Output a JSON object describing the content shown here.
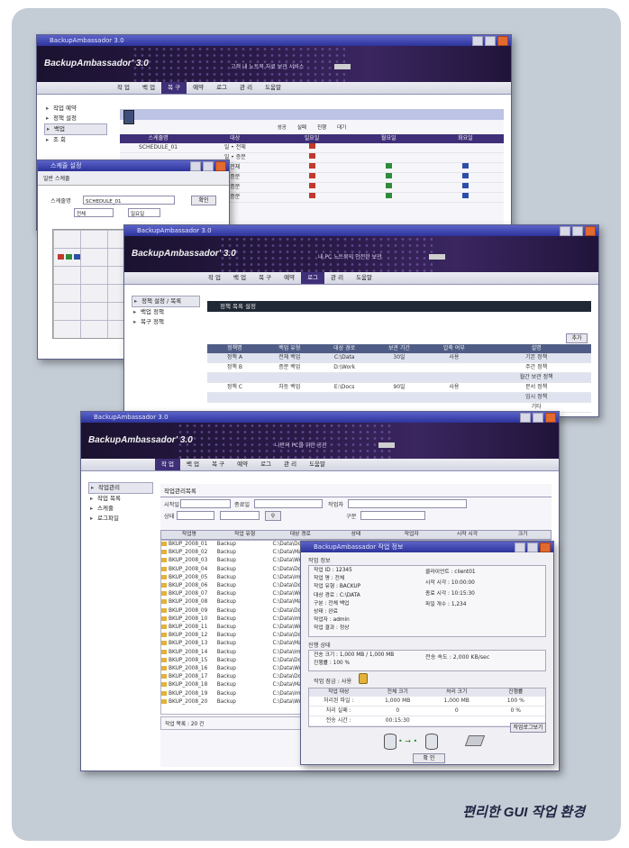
{
  "caption": "편리한 GUI 작업 환경",
  "app": {
    "logo": "BackupAmbassador' 3.0",
    "tagline1": "고객 내 노트북 자료 보관 서비스",
    "tagline2": "내 PC 노트북의 안전한 보관",
    "tagline3": "나만의 PC를 위한 공간",
    "menu": [
      "작 업",
      "백 업",
      "복 구",
      "예약",
      "로그",
      "관 리",
      "도움말"
    ]
  },
  "win1": {
    "title": "BackupAmbassador 3.0",
    "tree": [
      "작업 예약",
      "정책 설정",
      "백업",
      "조 회"
    ],
    "legend": [
      "성공",
      "실패",
      "진행",
      "대기"
    ],
    "columns": [
      "스케줄명",
      "대상",
      "일요일",
      "월요일",
      "화요일"
    ],
    "rows": [
      [
        "SCHEDULE_01",
        "일 • 전체",
        "r",
        "",
        ""
      ],
      [
        "",
        "일 • 증분",
        "r",
        "",
        ""
      ],
      [
        "",
        "전체",
        "r",
        "g",
        "b"
      ],
      [
        "",
        "증분",
        "r",
        "g",
        "b"
      ],
      [
        "",
        "증분",
        "r",
        "g",
        "b"
      ],
      [
        "",
        "증분",
        "r",
        "g",
        "b"
      ]
    ]
  },
  "win2": {
    "title": "스케줄 설정",
    "tab": "일반 스케줄",
    "field_label": "스케줄명",
    "field_value": "SCHEDULE_01",
    "select1": "전체",
    "select2": "일요일",
    "ok_label": "확인",
    "close_label": "닫기"
  },
  "win3": {
    "title": "BackupAmbassador 3.0",
    "tree": [
      "정책 설정 / 목록",
      "백업 정책",
      "복구 정책"
    ],
    "section": "정책 목록 설정",
    "add_label": "추가",
    "columns": [
      "정책명",
      "백업 유형",
      "대상 경로",
      "보관 기간",
      "압축 여부",
      "설명"
    ],
    "rows": [
      [
        "정책 A",
        "전체 백업",
        "C:\\Data",
        "30일",
        "사용",
        "기본 정책"
      ],
      [
        "정책 B",
        "증분 백업",
        "D:\\Work",
        "",
        "",
        "주간 정책"
      ],
      [
        "",
        "",
        "",
        "",
        "",
        "월간 보관 정책"
      ],
      [
        "정책 C",
        "차등 백업",
        "E:\\Docs",
        "90일",
        "사용",
        "문서 정책"
      ],
      [
        "",
        "",
        "",
        "",
        "",
        "임시 정책"
      ],
      [
        "",
        "",
        "",
        "",
        "",
        "기타"
      ]
    ]
  },
  "win4": {
    "title": "BackupAmbassador 3.0",
    "tree": [
      "작업관리",
      "작업 목록",
      "스케줄",
      "로그파일"
    ],
    "section": "작업관리목록",
    "filter_labels": [
      "시작일",
      "종료일",
      "작업자",
      "상태",
      "구분"
    ],
    "columns": [
      "작업명",
      "작업 유형",
      "대상 경로",
      "상태",
      "작업자",
      "시작 시각",
      "크기"
    ],
    "files": [
      [
        "BKUP_2008_01",
        "Backup",
        "C:\\Data\\Docs",
        "완료",
        "admin",
        "2008-11-21 10:00",
        "3.2MB"
      ],
      [
        "BKUP_2008_02",
        "Backup",
        "C:\\Data\\Mail",
        "완료",
        "admin",
        "2008-11-21 10:05",
        "1.1MB"
      ],
      [
        "BKUP_2008_03",
        "Backup",
        "C:\\Data\\Work",
        "완료",
        "admin",
        "2008-11-21 10:10",
        "4.7MB"
      ],
      [
        "BKUP_2008_04",
        "Backup",
        "C:\\Data\\Docs",
        "완료",
        "admin",
        "2008-11-21 10:15",
        "0.8MB"
      ],
      [
        "BKUP_2008_05",
        "Backup",
        "C:\\Data\\Img",
        "완료",
        "admin",
        "2008-11-21 10:20",
        "2.3MB"
      ],
      [
        "BKUP_2008_06",
        "Backup",
        "C:\\Data\\Docs",
        "완료",
        "admin",
        "2008-11-21 10:25",
        "1.9MB"
      ],
      [
        "BKUP_2008_07",
        "Backup",
        "C:\\Data\\Work",
        "완료",
        "admin",
        "2008-11-21 10:30",
        "5.0MB"
      ],
      [
        "BKUP_2008_08",
        "Backup",
        "C:\\Data\\Mail",
        "완료",
        "admin",
        "2008-11-21 10:35",
        "0.6MB"
      ],
      [
        "BKUP_2008_09",
        "Backup",
        "C:\\Data\\Docs",
        "완료",
        "admin",
        "2008-11-21 10:40",
        "2.8MB"
      ],
      [
        "BKUP_2008_10",
        "Backup",
        "C:\\Data\\Img",
        "완료",
        "admin",
        "2008-11-21 10:45",
        "3.6MB"
      ],
      [
        "BKUP_2008_11",
        "Backup",
        "C:\\Data\\Work",
        "완료",
        "admin",
        "2008-11-21 10:50",
        "1.4MB"
      ],
      [
        "BKUP_2008_12",
        "Backup",
        "C:\\Data\\Docs",
        "완료",
        "admin",
        "2008-11-21 10:55",
        "2.0MB"
      ],
      [
        "BKUP_2008_13",
        "Backup",
        "C:\\Data\\Mail",
        "완료",
        "admin",
        "2008-11-21 11:00",
        "0.9MB"
      ],
      [
        "BKUP_2008_14",
        "Backup",
        "C:\\Data\\Img",
        "완료",
        "admin",
        "2008-11-21 11:05",
        "4.1MB"
      ],
      [
        "BKUP_2008_15",
        "Backup",
        "C:\\Data\\Docs",
        "완료",
        "admin",
        "2008-11-21 11:10",
        "1.7MB"
      ],
      [
        "BKUP_2008_16",
        "Backup",
        "C:\\Data\\Work",
        "완료",
        "admin",
        "2008-11-21 11:15",
        "2.5MB"
      ],
      [
        "BKUP_2008_17",
        "Backup",
        "C:\\Data\\Docs",
        "완료",
        "admin",
        "2008-11-21 11:20",
        "3.3MB"
      ],
      [
        "BKUP_2008_18",
        "Backup",
        "C:\\Data\\Mail",
        "완료",
        "admin",
        "2008-11-21 11:25",
        "0.7MB"
      ],
      [
        "BKUP_2008_19",
        "Backup",
        "C:\\Data\\Img",
        "완료",
        "admin",
        "2008-11-21 11:30",
        "2.9MB"
      ],
      [
        "BKUP_2008_20",
        "Backup",
        "C:\\Data\\Work",
        "완료",
        "admin",
        "2008-11-21 11:35",
        "1.2MB"
      ]
    ],
    "status": "작업 목록 : 20 건"
  },
  "dialog": {
    "title": "BackupAmbassador 작업 정보",
    "section1": "작업 정보",
    "lines1": [
      "작업 ID : 12345",
      "작업 명 : 전체",
      "작업 유형 : BACKUP",
      "대상 경로 : C:\\DATA",
      "구분 : 전체 백업",
      "상태 : 완료",
      "작업자 : admin",
      "작업 결과 : 정상"
    ],
    "lines1b": [
      "클라이언트 : client01",
      "시작 시각 : 10:00:00",
      "종료 시각 : 10:15:30",
      "파일 개수 : 1,234"
    ],
    "section2": "진행 상태",
    "lines2": [
      "전송 크기 : 1,000 MB / 1,000 MB",
      "진행률 : 100 %"
    ],
    "lines2b": "전송 속도 : 2,000 KB/sec",
    "lock_label": "작업 잠금 : 사용",
    "table_head": [
      "작업 대상",
      "전체 크기",
      "처리 크기",
      "진행률"
    ],
    "table_rows": [
      [
        "처리된 파일 : ",
        "1,000 MB",
        "1,000 MB",
        "100 %"
      ],
      [
        "처리 실패 : ",
        "0",
        "0",
        "0 %"
      ],
      [
        "전송 시간 : ",
        "00:15:30",
        "",
        ""
      ]
    ],
    "detail_btn": "작업로그보기",
    "ok_btn": "확 인"
  },
  "colors": {
    "accent": "#3f2f78",
    "panel": "#c4ccd6",
    "flag_red": "#c0392b",
    "flag_green": "#2e8b3a",
    "flag_blue": "#2b4fa8"
  }
}
